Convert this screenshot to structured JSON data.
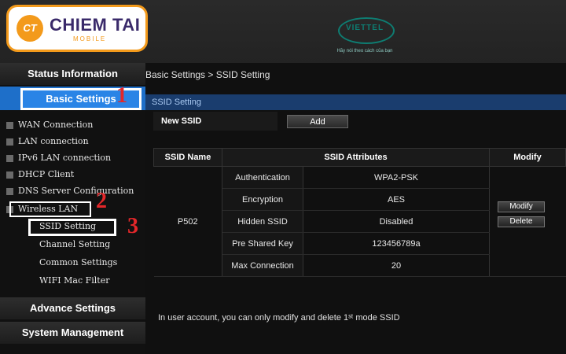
{
  "header": {
    "logo_initials": "CT",
    "logo_name": "CHIEM TAI",
    "logo_sub": "MOBILE",
    "brand_name": "VIETTEL",
    "brand_tagline": "Hãy nói theo cách của bạn"
  },
  "sidebar": {
    "status_information": "Status Information",
    "basic_settings": "Basic Settings",
    "items": [
      {
        "label": "WAN Connection"
      },
      {
        "label": "LAN connection"
      },
      {
        "label": "IPv6 LAN connection"
      },
      {
        "label": "DHCP Client"
      },
      {
        "label": "DNS Server Configuration"
      },
      {
        "label": "Wireless LAN"
      }
    ],
    "wireless_children": [
      {
        "label": "SSID Setting"
      },
      {
        "label": "Channel Setting"
      },
      {
        "label": "Common Settings"
      },
      {
        "label": "WIFI Mac Filter"
      }
    ],
    "advance_settings": "Advance Settings",
    "system_management": "System Management",
    "step_numbers": [
      "1",
      "2",
      "3"
    ]
  },
  "main": {
    "breadcrumb": "Basic Settings > SSID Setting",
    "section_title": "SSID Setting",
    "new_ssid_label": "New SSID",
    "add_button": "Add",
    "table": {
      "headers": [
        "SSID Name",
        "SSID Attributes",
        "Modify"
      ],
      "ssid_name": "P502",
      "attributes": [
        {
          "name": "Authentication",
          "value": "WPA2-PSK"
        },
        {
          "name": "Encryption",
          "value": "AES"
        },
        {
          "name": "Hidden SSID",
          "value": "Disabled"
        },
        {
          "name": "Pre Shared Key",
          "value": "123456789a"
        },
        {
          "name": "Max Connection",
          "value": "20"
        }
      ],
      "modify_button": "Modify",
      "delete_button": "Delete"
    },
    "note": "In user account, you can only modify and delete 1ˢᵗ mode SSID"
  },
  "colors": {
    "accent": "#1e6fc9",
    "highlight_number": "#e3272a",
    "logo_orange": "#f39a1b"
  }
}
